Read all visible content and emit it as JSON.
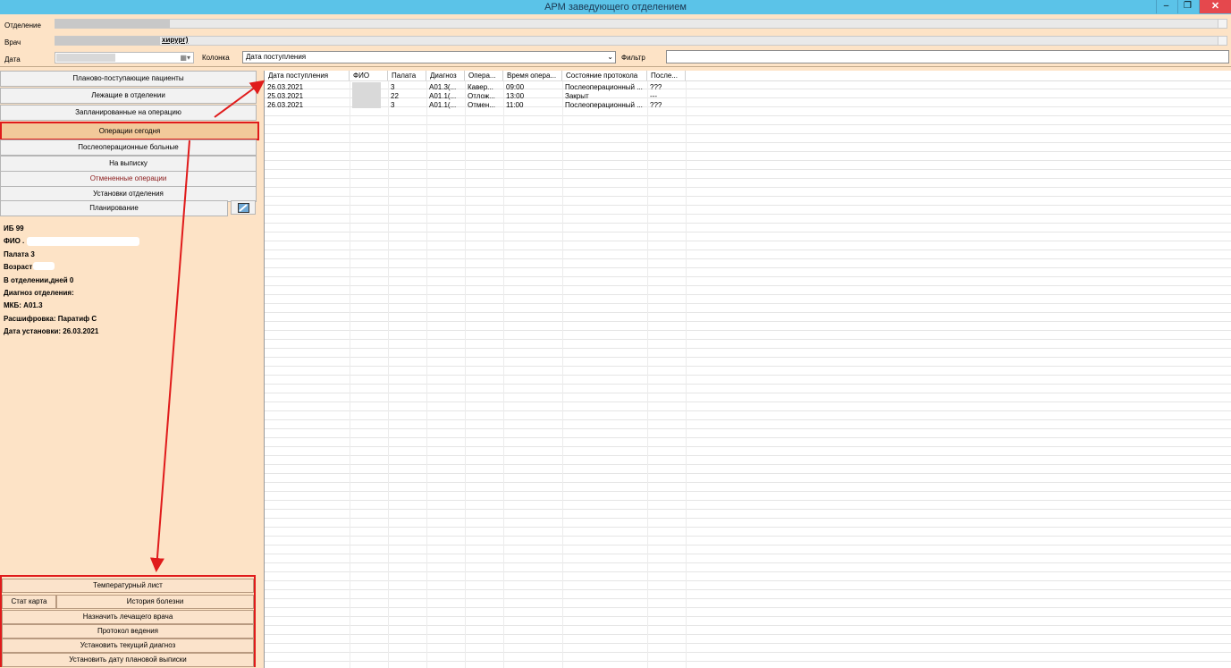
{
  "window": {
    "title": "АРМ заведующего отделением",
    "minimize": "–",
    "restore": "❐",
    "close": "✕"
  },
  "filters": {
    "department_label": "Отделение",
    "doctor_label": "Врач",
    "doctor_value": "хирург)",
    "date_label": "Дата",
    "column_label": "Колонка",
    "column_value": "Дата поступления",
    "filter_label": "Фильтр"
  },
  "nav": {
    "items": [
      {
        "label": "Планово-поступающие пациенты"
      },
      {
        "label": "Лежащие в отделении"
      },
      {
        "label": "Запланированные на операцию"
      },
      {
        "label": "Операции сегодня"
      },
      {
        "label": "Послеоперационные больные"
      },
      {
        "label": "На выписку"
      },
      {
        "label": "Отмененные операции"
      },
      {
        "label": "Установки отделения"
      },
      {
        "label": "Планирование"
      }
    ],
    "active_index": 3
  },
  "patient": {
    "ib": "ИБ 99",
    "fio": "ФИО .",
    "ward": "Палата 3",
    "age": "Возраст",
    "days": "В отделении,дней 0",
    "dept_diag": "Диагноз отделения:",
    "mkb": "МКБ: A01.3",
    "decode": "Расшифровка: Паратиф С",
    "set_date": "Дата установки: 26.03.2021"
  },
  "table": {
    "columns": [
      "Дата поступления",
      "ФИО",
      "Палата",
      "Диагноз",
      "Опера...",
      "Время опера...",
      "Состояние протокола",
      "После..."
    ],
    "rows": [
      [
        "26.03.2021",
        "",
        "3",
        "A01.3(...",
        "Кавер...",
        "09:00",
        "Послеоперационный ...",
        "???"
      ],
      [
        "25.03.2021",
        "",
        "22",
        "A01.1(...",
        "Отлож...",
        "13:00",
        "Закрыт",
        "---"
      ],
      [
        "26.03.2021",
        "",
        "3",
        "A01.1(...",
        "Отмен...",
        "11:00",
        "Послеоперационный ...",
        "???"
      ]
    ]
  },
  "actions": {
    "temp_sheet": "Температурный лист",
    "stat_card": "Стат карта",
    "history": "История болезни",
    "assign_doctor": "Назначить лечащего врача",
    "protocol": "Протокол ведения",
    "set_diag": "Установить текущий диагноз",
    "set_discharge": "Установить дату плановой выписки"
  },
  "colors": {
    "accent": "#e01b1b",
    "panel": "#fde3c6",
    "titlebar": "#5bc3e8"
  }
}
